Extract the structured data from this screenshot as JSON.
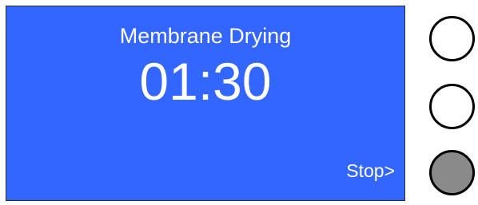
{
  "screen": {
    "title": "Membrane Drying",
    "timer": "01:30",
    "action_label": "Stop>"
  },
  "colors": {
    "screen_background": "#3366ff",
    "screen_text": "#ffffff",
    "button_idle": "#ffffff",
    "button_active": "#8a8a8a",
    "button_border": "#000000"
  },
  "hardware_buttons": [
    {
      "state": "idle"
    },
    {
      "state": "idle"
    },
    {
      "state": "active"
    }
  ]
}
